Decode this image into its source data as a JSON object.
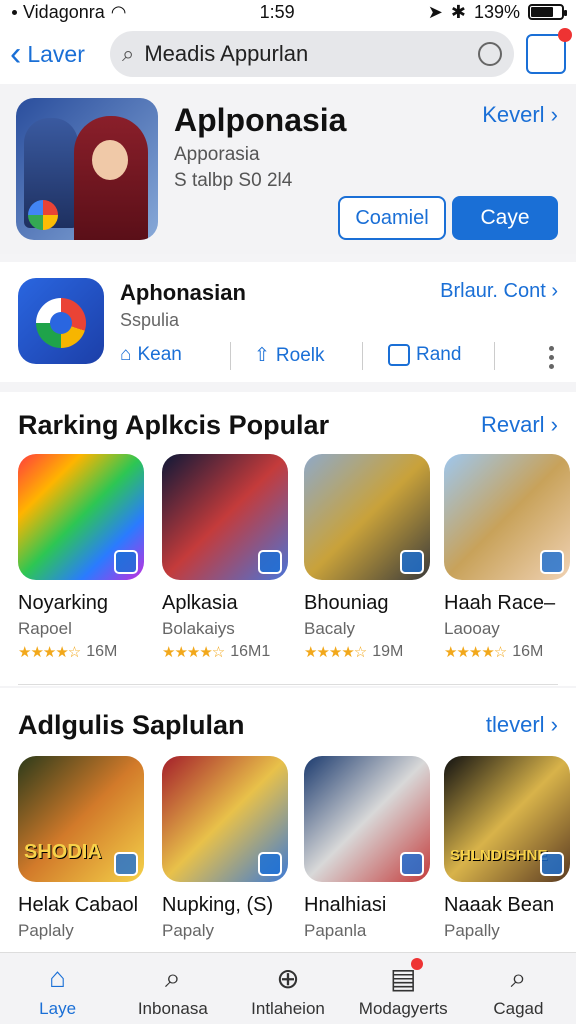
{
  "status": {
    "carrier": "Vidagonra",
    "time": "1:59",
    "battery": "139%"
  },
  "nav": {
    "back_label": "Laver",
    "search_value": "Meadis",
    "search_strong": "Appurlan"
  },
  "hero": {
    "title": "Aplponasia",
    "subtitle": "Apporasia",
    "meta": "S talbp S0 2l4",
    "link": "Keverl",
    "btn_outline": "Coamiel",
    "btn_solid": "Caye"
  },
  "app": {
    "title": "Aphonasian",
    "subtitle": "Sspulia",
    "link": "Brlaur. Cont",
    "actions": [
      "Kean",
      "Roelk",
      "Rand"
    ]
  },
  "ranking": {
    "title": "Rarking Aplkcis Popular",
    "link": "Revarl",
    "items": [
      {
        "name": "Noyarking",
        "publisher": "Rapoel",
        "rating": "★★★★☆",
        "count": "16M",
        "colors": [
          "#ff3d3d",
          "#ffb400",
          "#2dc653",
          "#2a7bff",
          "#c22fe0"
        ]
      },
      {
        "name": "Aplkasia",
        "publisher": "Bolakaiys",
        "rating": "★★★★☆",
        "count": "16M1",
        "colors": [
          "#0e1838",
          "#c43b3b",
          "#4a74d8"
        ]
      },
      {
        "name": "Bhouniag",
        "publisher": "Bacaly",
        "rating": "★★★★☆",
        "count": "19M",
        "colors": [
          "#8fa9c8",
          "#c9a23a",
          "#3b3b3b"
        ]
      },
      {
        "name": "Haah Race–",
        "publisher": "Laooay",
        "rating": "★★★★☆",
        "count": "16M",
        "colors": [
          "#9ec7ee",
          "#c8a25a",
          "#f0d2b4"
        ]
      }
    ]
  },
  "featured": {
    "title": "Adlgulis Saplulan",
    "link": "tleverl",
    "items": [
      {
        "name": "Helak Cabaol",
        "publisher": "Paplaly",
        "label": "SHODIA",
        "colors": [
          "#2b3a1a",
          "#d27a2a",
          "#f4d24a"
        ]
      },
      {
        "name": "Nupking, (S)",
        "publisher": "Papaly",
        "label": "",
        "colors": [
          "#a41e2a",
          "#e8c14a",
          "#3c7ad6"
        ]
      },
      {
        "name": "Hnalhiasi",
        "publisher": "Papanla",
        "label": "",
        "colors": [
          "#1b3a6e",
          "#d8d8d8",
          "#c43b3b"
        ]
      },
      {
        "name": "Naaak Bean",
        "publisher": "Papally",
        "label": "SHLNDISHNE",
        "colors": [
          "#111111",
          "#d8b34a",
          "#5a3a22"
        ]
      }
    ]
  },
  "tabs": [
    {
      "label": "Laye",
      "icon": "home-icon"
    },
    {
      "label": "Inbonasa",
      "icon": "search-icon"
    },
    {
      "label": "Intlaheion",
      "icon": "plus-circle-icon"
    },
    {
      "label": "Modagyerts",
      "icon": "updates-icon"
    },
    {
      "label": "Cagad",
      "icon": "search-icon"
    }
  ]
}
